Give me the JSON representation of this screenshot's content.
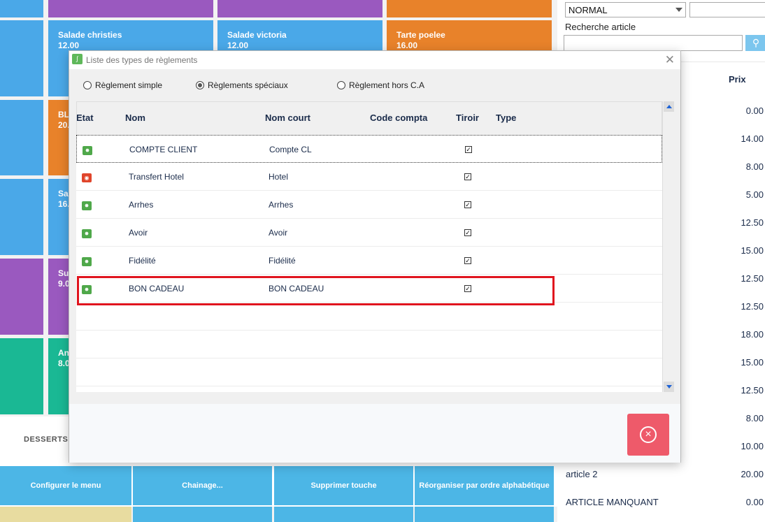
{
  "tiles": [
    {
      "name": "Salade christies",
      "price": "12.00"
    },
    {
      "name": "Salade victoria",
      "price": "12.00"
    },
    {
      "name": "Tarte poelee",
      "price": "16.00"
    },
    {
      "name": "BL",
      "price": "20."
    },
    {
      "name": "Sal",
      "price": "16."
    },
    {
      "name": "Su",
      "price": "9.0"
    },
    {
      "name": "Ant",
      "price": "8.0"
    }
  ],
  "category_label": "DESSERTS",
  "bottom_buttons": [
    "Configurer le menu",
    "Chainage...",
    "Supprimer touche",
    "Réorganiser par ordre alphabétique"
  ],
  "right_panel": {
    "mode_select": "NORMAL",
    "search_label": "Recherche article",
    "price_header": "Prix",
    "prices": [
      "0.00",
      "14.00",
      "8.00",
      "5.00",
      "12.50",
      "15.00",
      "12.50",
      "12.50",
      "18.00",
      "15.00",
      "12.50",
      "8.00",
      "10.00",
      "20.00",
      "0.00"
    ],
    "named_articles": [
      {
        "name": "article 2",
        "price": "20.00"
      },
      {
        "name": "ARTICLE MANQUANT",
        "price": "0.00"
      }
    ]
  },
  "dialog": {
    "title": "Liste des types de règlements",
    "radios": [
      {
        "label": "Règlement simple",
        "checked": false
      },
      {
        "label": "Règlements spéciaux",
        "checked": true
      },
      {
        "label": "Règlement hors C.A",
        "checked": false
      }
    ],
    "columns": [
      "Etat",
      "Nom",
      "Nom court",
      "Code compta",
      "Tiroir",
      "Type"
    ],
    "rows": [
      {
        "state": "ok",
        "nom": "COMPTE CLIENT",
        "nom_court": "Compte CL",
        "code": "",
        "tiroir": true,
        "type": ""
      },
      {
        "state": "ko",
        "nom": "Transfert Hotel",
        "nom_court": "Hotel",
        "code": "",
        "tiroir": true,
        "type": ""
      },
      {
        "state": "ok",
        "nom": "Arrhes",
        "nom_court": "Arrhes",
        "code": "",
        "tiroir": true,
        "type": ""
      },
      {
        "state": "ok",
        "nom": "Avoir",
        "nom_court": "Avoir",
        "code": "",
        "tiroir": true,
        "type": ""
      },
      {
        "state": "ok",
        "nom": "Fidélité",
        "nom_court": "Fidélité",
        "code": "",
        "tiroir": true,
        "type": ""
      },
      {
        "state": "ok",
        "nom": "BON CADEAU",
        "nom_court": "BON CADEAU",
        "code": "",
        "tiroir": true,
        "type": ""
      }
    ],
    "highlighted_row": 5
  }
}
